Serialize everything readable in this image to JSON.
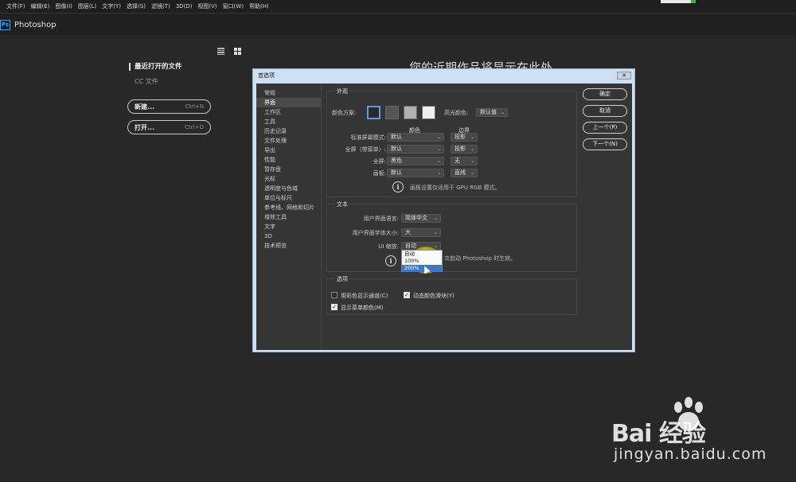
{
  "menubar": {
    "items": [
      "文件(F)",
      "编辑(E)",
      "图像(I)",
      "图层(L)",
      "文字(Y)",
      "选择(S)",
      "滤镜(T)",
      "3D(D)",
      "视图(V)",
      "窗口(W)",
      "帮助(H)"
    ]
  },
  "app": {
    "logo": "Ps",
    "name": "Photoshop"
  },
  "home": {
    "recent_title": "最近打开的文件",
    "cc_files": "CC 文件",
    "new_label": "新建...",
    "new_shortcut": "Ctrl+N",
    "open_label": "打开...",
    "open_shortcut": "Ctrl+O",
    "placeholder": "您的近期作品将显示在此处"
  },
  "dialog": {
    "title": "首选项",
    "close": "✕",
    "sidebar": [
      "常规",
      "界面",
      "工作区",
      "工具",
      "历史记录",
      "文件处理",
      "导出",
      "性能",
      "暂存盘",
      "光标",
      "透明度与色域",
      "单位与标尺",
      "参考线、网格和切片",
      "增效工具",
      "文字",
      "3D",
      "技术预览"
    ],
    "selected_index": 1,
    "appearance": {
      "label": "外观",
      "color_scheme_label": "颜色方案:",
      "highlight_label": "高光颜色:",
      "highlight_value": "默认值",
      "col_color": "颜色",
      "col_border": "边界",
      "rows": [
        {
          "label": "标准屏幕模式:",
          "color": "默认",
          "border": "投影"
        },
        {
          "label": "全屏（带菜单）:",
          "color": "默认",
          "border": "投影"
        },
        {
          "label": "全屏:",
          "color": "黑色",
          "border": "无"
        },
        {
          "label": "画板:",
          "color": "默认",
          "border": "直线"
        }
      ],
      "note": "画板设置仅适用于 GPU RGB 模式。"
    },
    "text": {
      "label": "文本",
      "lang_label": "用户界面语言:",
      "lang_value": "简体中文",
      "font_size_label": "用户界面字体大小:",
      "font_size_value": "大",
      "scale_label": "UI 缩放:",
      "scale_value": "自动",
      "scale_options": [
        "自动",
        "100%",
        "200%"
      ],
      "note": "次启动 Photoshop 时生效。"
    },
    "options": {
      "label": "选项",
      "checkboxes": [
        {
          "label": "用彩色显示通道(C)",
          "checked": false
        },
        {
          "label": "动态颜色滑块(Y)",
          "checked": true
        },
        {
          "label": "显示菜单颜色(M)",
          "checked": true
        }
      ]
    },
    "buttons": {
      "ok": "确定",
      "cancel": "取消",
      "prev": "上一个(P)",
      "next": "下一个(N)"
    },
    "swatch_colors": [
      "#2a2a2a",
      "#555555",
      "#b0b0b0",
      "#efefef"
    ]
  },
  "watermark": {
    "brand": "Bai  经验",
    "url": "jingyan.baidu.com"
  }
}
